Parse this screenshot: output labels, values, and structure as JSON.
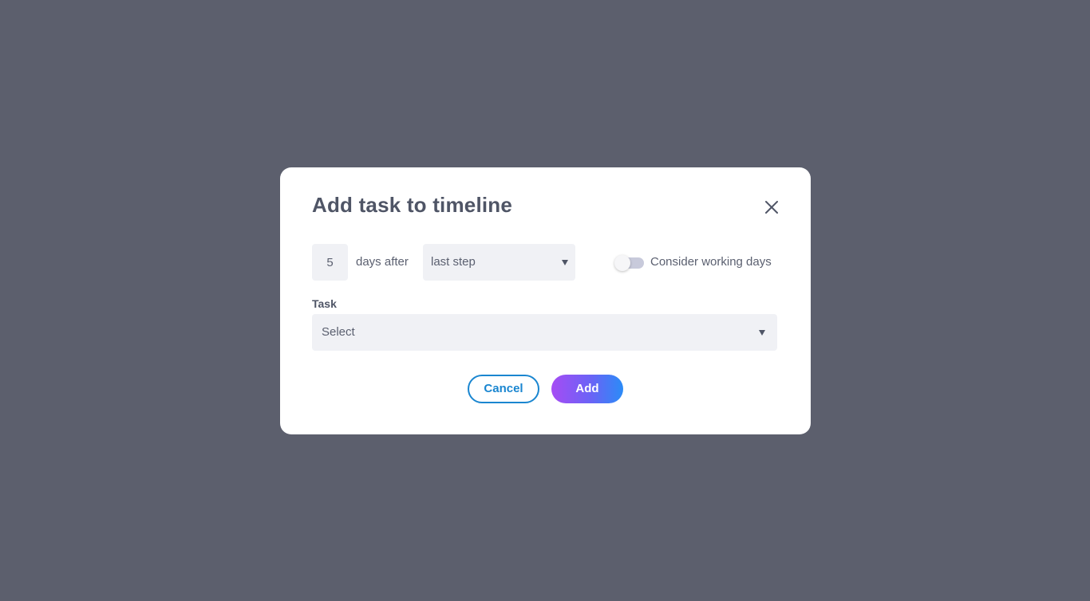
{
  "modal": {
    "title": "Add task to timeline",
    "close_icon": "close-icon"
  },
  "schedule": {
    "days_value": "5",
    "days_after_label": "days after",
    "step_select": {
      "selected": "last step"
    },
    "working_days_toggle": {
      "label": "Consider working days",
      "enabled": false
    }
  },
  "task": {
    "label": "Task",
    "select_placeholder": "Select"
  },
  "actions": {
    "cancel_label": "Cancel",
    "add_label": "Add"
  },
  "colors": {
    "backdrop": "#5c5f6d",
    "title": "#4f5566",
    "field_bg": "#f0f1f5",
    "cancel_border": "#1a86d0",
    "add_gradient_start": "#a64cf4",
    "add_gradient_end": "#2b8cf7"
  }
}
